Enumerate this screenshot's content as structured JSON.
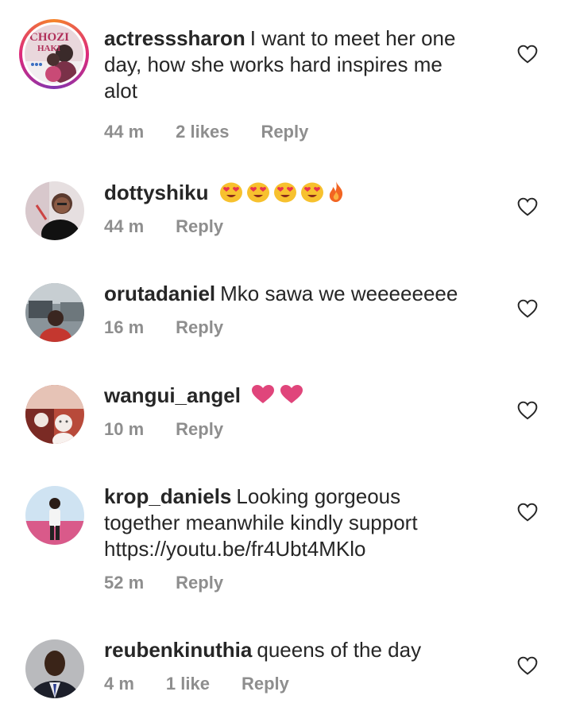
{
  "comments": [
    {
      "username": "actresssharon",
      "text": "I want to meet her one day, how she works hard inspires me alot",
      "time": "44 m",
      "likes": "2 likes",
      "reply": "Reply",
      "avatar": {
        "logo_text_1": "CHOZI",
        "logo_text_2": "HAKI"
      }
    },
    {
      "username": "dottyshiku",
      "text": "",
      "emojis": [
        "heart-eyes-emoji",
        "heart-eyes-emoji",
        "heart-eyes-emoji",
        "heart-eyes-emoji",
        "fire-emoji"
      ],
      "time": "44 m",
      "likes": "",
      "reply": "Reply"
    },
    {
      "username": "orutadaniel",
      "text": "Mko sawa we weeeeeeee",
      "time": "16 m",
      "likes": "",
      "reply": "Reply"
    },
    {
      "username": "wangui_angel",
      "text": "",
      "emojis": [
        "pink-heart-emoji",
        "pink-heart-emoji"
      ],
      "time": "10 m",
      "likes": "",
      "reply": "Reply"
    },
    {
      "username": "krop_daniels",
      "text": "Looking gorgeous together  meanwhile kindly support https://youtu.be/fr4Ubt4MKlo",
      "time": "52 m",
      "likes": "",
      "reply": "Reply"
    },
    {
      "username": "reubenkinuthia",
      "text": "queens of the day",
      "time": "4 m",
      "likes": "1 like",
      "reply": "Reply"
    }
  ],
  "colors": {
    "text": "#262626",
    "meta": "#8e8e8e",
    "heart_pink": "#e0457b",
    "emoji_yellow": "#f7c12e",
    "fire": "#f26522"
  }
}
